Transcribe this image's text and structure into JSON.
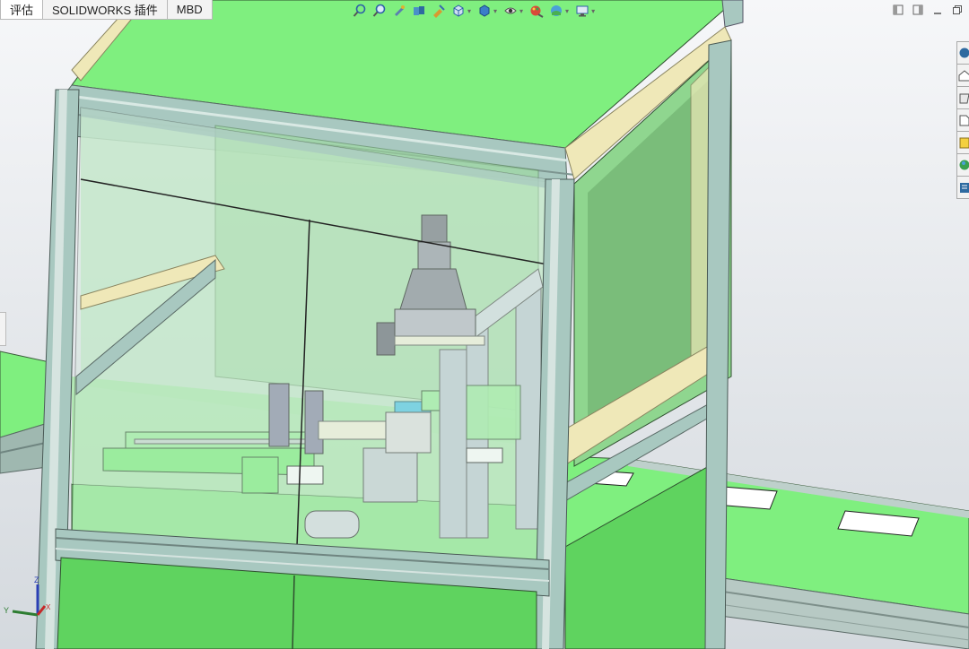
{
  "command_tabs": [
    {
      "label": "评估"
    },
    {
      "label": "SOLIDWORKS 插件"
    },
    {
      "label": "MBD"
    }
  ],
  "heads_up_toolbar": [
    {
      "icon": "zoom-to-fit-icon"
    },
    {
      "icon": "zoom-to-area-icon"
    },
    {
      "icon": "previous-view-icon"
    },
    {
      "icon": "section-view-icon"
    },
    {
      "icon": "dynamic-annotation-icon"
    },
    {
      "icon": "view-orientation-icon"
    },
    {
      "icon": "display-style-icon"
    },
    {
      "icon": "hide-show-items-icon"
    },
    {
      "icon": "edit-appearance-icon"
    },
    {
      "icon": "apply-scene-icon"
    },
    {
      "icon": "view-settings-icon"
    }
  ],
  "window_controls": [
    "tile-left-icon",
    "tile-right-icon",
    "minimize-icon",
    "restore-icon"
  ],
  "task_pane": [
    {
      "icon": "solidworks-resources-icon"
    },
    {
      "icon": "home-icon"
    },
    {
      "icon": "design-library-icon"
    },
    {
      "icon": "file-explorer-icon"
    },
    {
      "icon": "view-palette-icon"
    },
    {
      "icon": "appearances-icon"
    },
    {
      "icon": "custom-properties-icon"
    }
  ],
  "triad": {
    "x_label": "X",
    "y_label": "Y",
    "z_label": "Z"
  },
  "colors": {
    "enclosure_green": "#7fef7f",
    "panel_green": "#5fd35f",
    "frame_profile": "#a8c8c0",
    "rail_beige": "#efe8b8",
    "glass": "#cfe8d8",
    "background_top": "#f4f5f7",
    "background_bottom": "#d6dbe0"
  }
}
